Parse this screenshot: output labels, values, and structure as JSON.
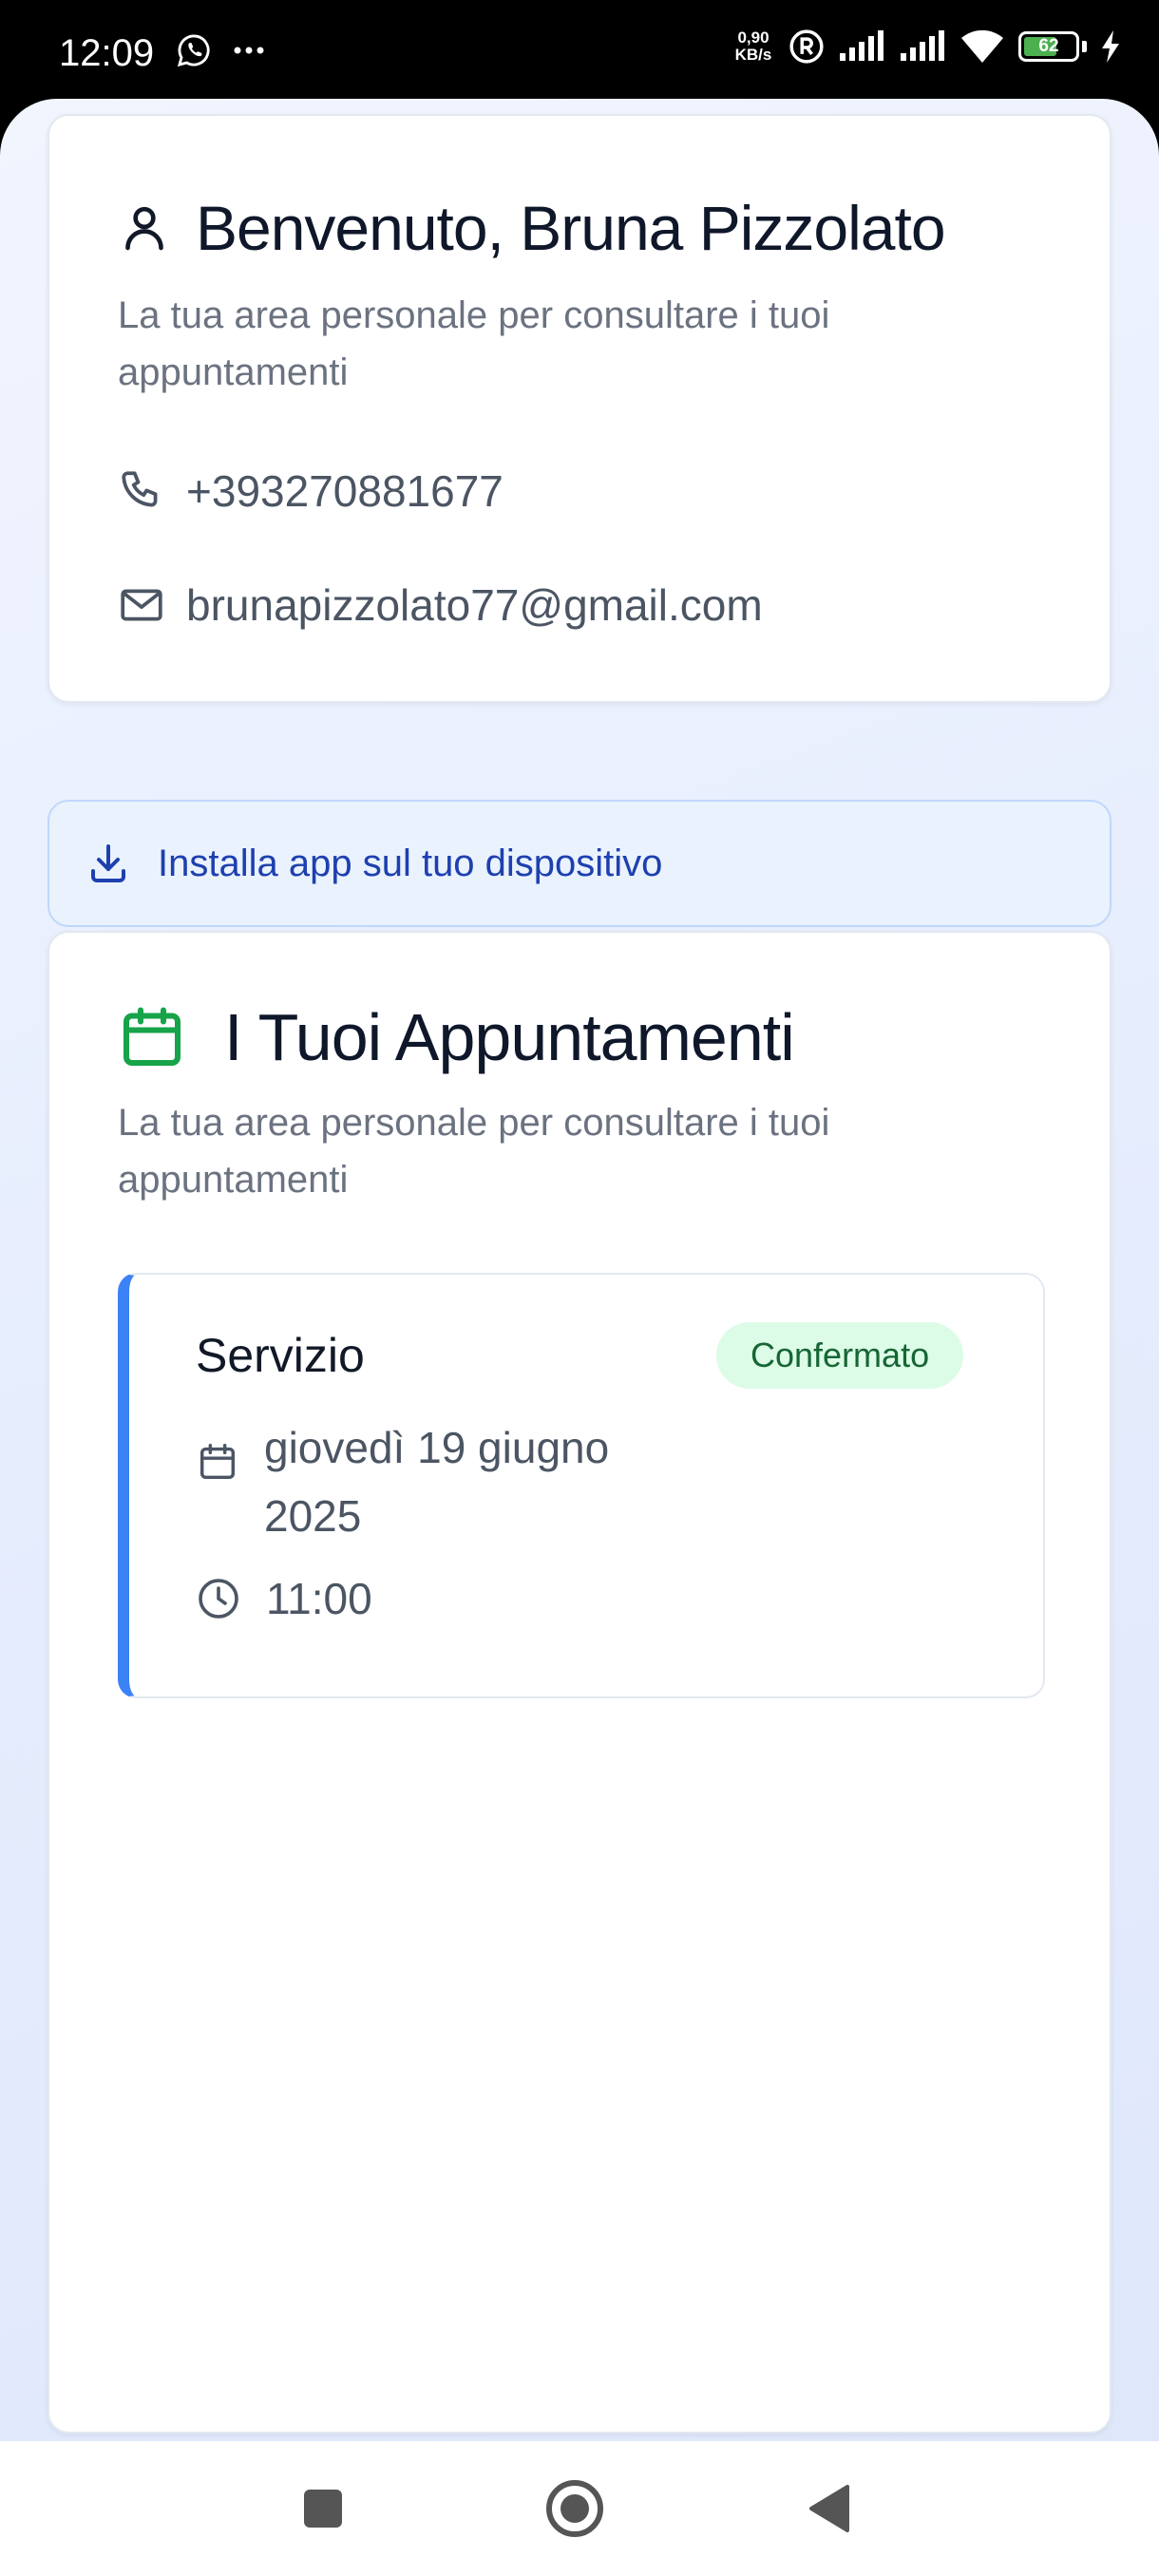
{
  "status_bar": {
    "time": "12:09",
    "net_speed_value": "0,90",
    "net_speed_unit": "KB/s",
    "battery_level": "62",
    "icons": [
      "whatsapp-icon",
      "more-dots-icon",
      "registered-icon",
      "signal-icon",
      "signal-icon",
      "wifi-icon",
      "battery-icon",
      "charging-bolt-icon"
    ]
  },
  "welcome": {
    "title": "Benvenuto, Bruna Pizzolato",
    "subtitle": "La tua area personale per consultare i tuoi appuntamenti",
    "icon": "user-icon",
    "phone": "+393270881677",
    "email": "brunapizzolato77@gmail.com"
  },
  "install_banner": {
    "label": "Installa app sul tuo dispositivo",
    "icon": "download-icon"
  },
  "appointments": {
    "title": "I Tuoi Appuntamenti",
    "subtitle": "La tua area personale per consultare i tuoi appuntamenti",
    "icon": "calendar-icon",
    "items": [
      {
        "service": "Servizio",
        "status": "Confermato",
        "date": "giovedì 19 giugno 2025",
        "time": "11:00"
      }
    ]
  },
  "colors": {
    "accent_blue": "#3b82f6",
    "calendar_green": "#16a34a",
    "badge_bg": "#dcfce7",
    "badge_text": "#166534",
    "banner_bg": "#eaf2fe",
    "banner_text": "#1e40af"
  },
  "nav_bar": {
    "buttons": [
      "recent-apps-icon",
      "home-icon",
      "back-icon"
    ]
  }
}
